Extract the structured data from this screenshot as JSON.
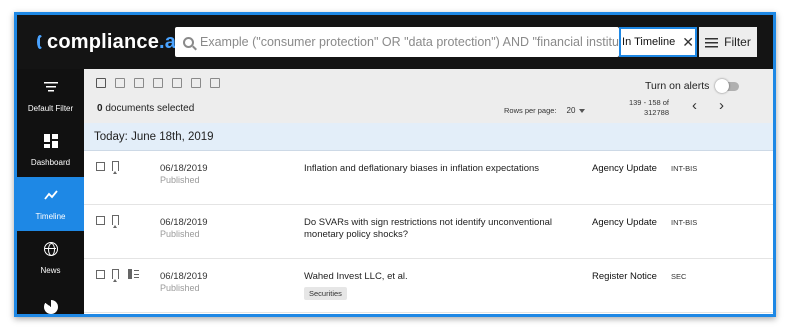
{
  "brand": {
    "name": "compliance",
    "tld": ".ai",
    "accent": "#4aa3ff"
  },
  "search": {
    "placeholder": "Example (\"consumer protection\" OR \"data protection\") AND \"financial institution\"",
    "scope_label": "In Timeline",
    "filter_label": "Filter"
  },
  "sidebar": {
    "items": [
      {
        "label": "Default Filter",
        "icon": "filter-icon"
      },
      {
        "label": "Dashboard",
        "icon": "dashboard-icon"
      },
      {
        "label": "Timeline",
        "icon": "timeline-icon",
        "active": true
      },
      {
        "label": "News",
        "icon": "globe-icon"
      },
      {
        "label": "",
        "icon": "pie-chart-icon"
      }
    ]
  },
  "toolbar": {
    "selected_count": "0",
    "selected_label": "documents selected",
    "alerts_label": "Turn on alerts",
    "rows_label": "Rows per page:",
    "rows_value": "20",
    "range_line1": "139 - 158 of",
    "range_line2": "312788",
    "prev": "‹",
    "next": "›"
  },
  "day_header": "Today: June 18th, 2019",
  "documents": [
    {
      "date": "06/18/2019",
      "status": "Published",
      "title": "Inflation and deflationary biases in inflation expectations",
      "tag": "",
      "type": "Agency Update",
      "agency": "INT-BIS"
    },
    {
      "date": "06/18/2019",
      "status": "Published",
      "title": "Do SVARs with sign restrictions not identify unconventional monetary policy shocks?",
      "tag": "",
      "type": "Agency Update",
      "agency": "INT-BIS"
    },
    {
      "date": "06/18/2019",
      "status": "Published",
      "title": "Wahed Invest LLC, et al.",
      "tag": "Securities",
      "type": "Register Notice",
      "agency": "SEC"
    }
  ],
  "colors": {
    "active_blue": "#1e88e5",
    "day_bar": "#e3eef9"
  }
}
